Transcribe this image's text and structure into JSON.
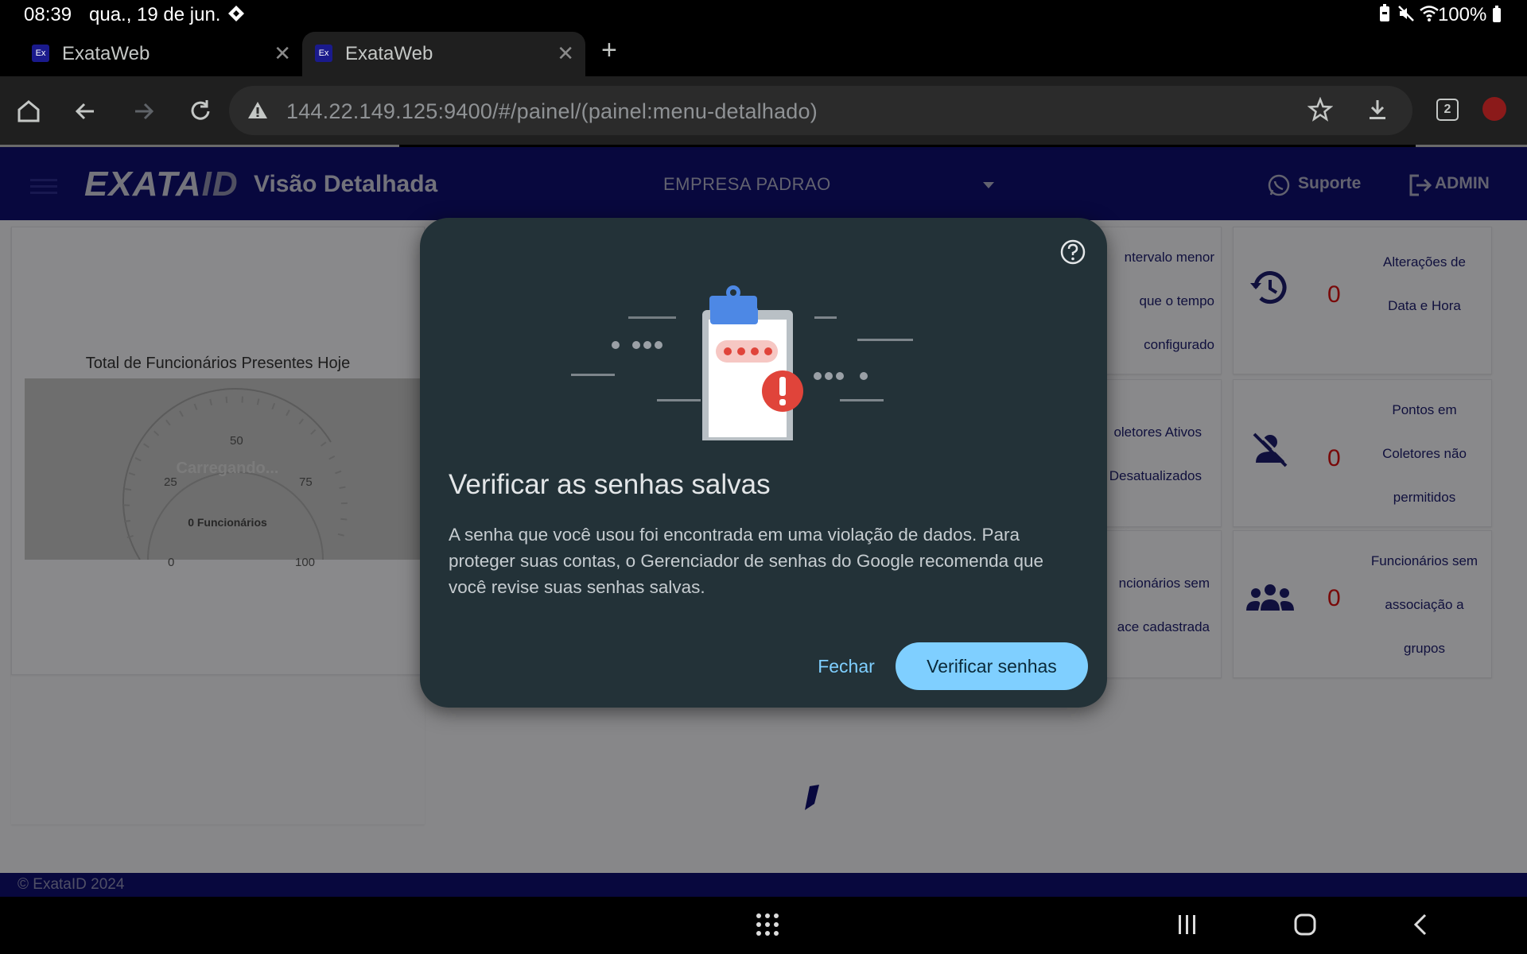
{
  "status_bar": {
    "time": "08:39",
    "date": "qua., 19 de jun.",
    "battery": "100%"
  },
  "browser": {
    "tabs": [
      {
        "favicon": "Ex",
        "title": "ExataWeb",
        "active": false
      },
      {
        "favicon": "Ex",
        "title": "ExataWeb",
        "active": true
      }
    ],
    "url": "144.22.149.125:9400/#/painel/(painel:menu-detalhado)",
    "tab_count": "2"
  },
  "app": {
    "logo_main": "EXATA",
    "logo_id": "ID",
    "page_title": "Visão Detalhada",
    "company": "EMPRESA PADRAO",
    "support_label": "Suporte",
    "admin_label": "ADMIN",
    "colors": {
      "header": "#0e0e6b",
      "value": "#d01010"
    }
  },
  "gauge": {
    "title": "Total de Funcionários Presentes Hoje",
    "loading": "Carregando...",
    "subtitle": "0 Funcionários",
    "ticks": [
      "0",
      "25",
      "50",
      "75",
      "100"
    ]
  },
  "kpis_partial": [
    {
      "lines": [
        "ntervalo menor",
        "que o tempo",
        "configurado"
      ]
    },
    {
      "lines": [
        "oletores Ativos",
        "Desatualizados"
      ]
    },
    {
      "lines": [
        "ncionários sem",
        "ace cadastrada"
      ]
    }
  ],
  "kpis": [
    {
      "icon": "history-icon",
      "value": "0",
      "lines": [
        "Alterações de",
        "Data e Hora"
      ]
    },
    {
      "icon": "user-off-icon",
      "value": "0",
      "lines": [
        "Pontos em",
        "Coletores não",
        "permitidos"
      ]
    },
    {
      "icon": "group-icon",
      "value": "0",
      "lines": [
        "Funcionários sem",
        "associação a",
        "grupos"
      ]
    }
  ],
  "footer": "© ExataID 2024",
  "dialog": {
    "title": "Verificar as senhas salvas",
    "body": "A senha que você usou foi encontrada em uma violação de dados. Para proteger suas contas, o Gerenciador de senhas do Google recomenda que você revise suas senhas salvas.",
    "close_label": "Fechar",
    "verify_label": "Verificar senhas",
    "colors": {
      "background": "#233238",
      "accent": "#7fcfff"
    }
  }
}
